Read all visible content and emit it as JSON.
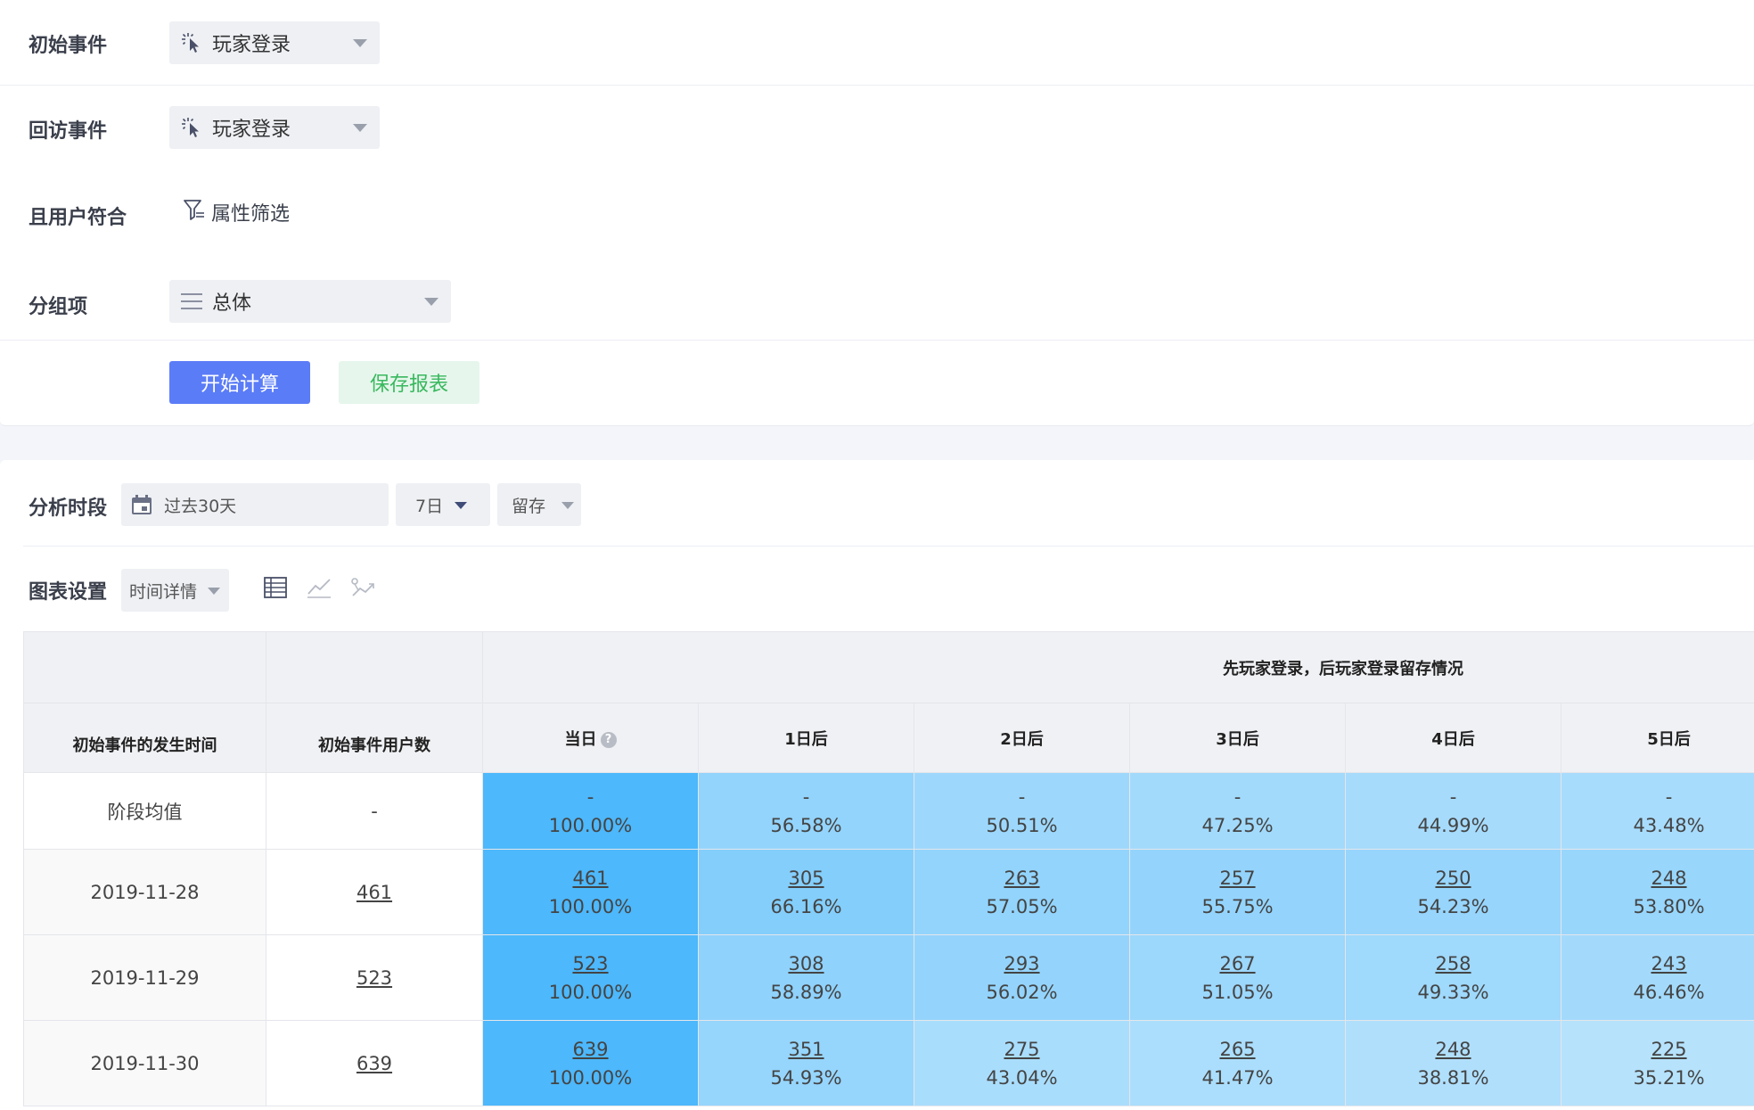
{
  "config": {
    "initial_event": {
      "label": "初始事件",
      "value": "玩家登录"
    },
    "return_event": {
      "label": "回访事件",
      "value": "玩家登录"
    },
    "user_filter": {
      "label": "且用户符合",
      "action": "属性筛选"
    },
    "group_by": {
      "label": "分组项",
      "value": "总体"
    },
    "compute_label": "开始计算",
    "save_label": "保存报表"
  },
  "analysis": {
    "period_label": "分析时段",
    "date_range": "过去30天",
    "window": "7日",
    "metric": "留存",
    "chart_settings_label": "图表设置",
    "chart_detail": "时间详情"
  },
  "table": {
    "group_header": "先玩家登录，后玩家登录留存情况",
    "col_date": "初始事件的发生时间",
    "col_users": "初始事件用户数",
    "day_cols": [
      "当日",
      "1日后",
      "2日后",
      "3日后",
      "4日后",
      "5日后"
    ],
    "help_glyph": "?",
    "rows": [
      {
        "date": "阶段均值",
        "users": "-",
        "cells": [
          {
            "n": "-",
            "p": "100.00%"
          },
          {
            "n": "-",
            "p": "56.58%"
          },
          {
            "n": "-",
            "p": "50.51%"
          },
          {
            "n": "-",
            "p": "47.25%"
          },
          {
            "n": "-",
            "p": "44.99%"
          },
          {
            "n": "-",
            "p": "43.48%"
          }
        ]
      },
      {
        "date": "2019-11-28",
        "users": "461",
        "cells": [
          {
            "n": "461",
            "p": "100.00%"
          },
          {
            "n": "305",
            "p": "66.16%"
          },
          {
            "n": "263",
            "p": "57.05%"
          },
          {
            "n": "257",
            "p": "55.75%"
          },
          {
            "n": "250",
            "p": "54.23%"
          },
          {
            "n": "248",
            "p": "53.80%"
          }
        ]
      },
      {
        "date": "2019-11-29",
        "users": "523",
        "cells": [
          {
            "n": "523",
            "p": "100.00%"
          },
          {
            "n": "308",
            "p": "58.89%"
          },
          {
            "n": "293",
            "p": "56.02%"
          },
          {
            "n": "267",
            "p": "51.05%"
          },
          {
            "n": "258",
            "p": "49.33%"
          },
          {
            "n": "243",
            "p": "46.46%"
          }
        ]
      },
      {
        "date": "2019-11-30",
        "users": "639",
        "cells": [
          {
            "n": "639",
            "p": "100.00%"
          },
          {
            "n": "351",
            "p": "54.93%"
          },
          {
            "n": "275",
            "p": "43.04%"
          },
          {
            "n": "265",
            "p": "41.47%"
          },
          {
            "n": "248",
            "p": "38.81%"
          },
          {
            "n": "225",
            "p": "35.21%"
          }
        ]
      }
    ]
  },
  "colors": {
    "primary": "#5b7cf7",
    "save_text": "#39b85e",
    "heat_max": "#4db8fb"
  }
}
